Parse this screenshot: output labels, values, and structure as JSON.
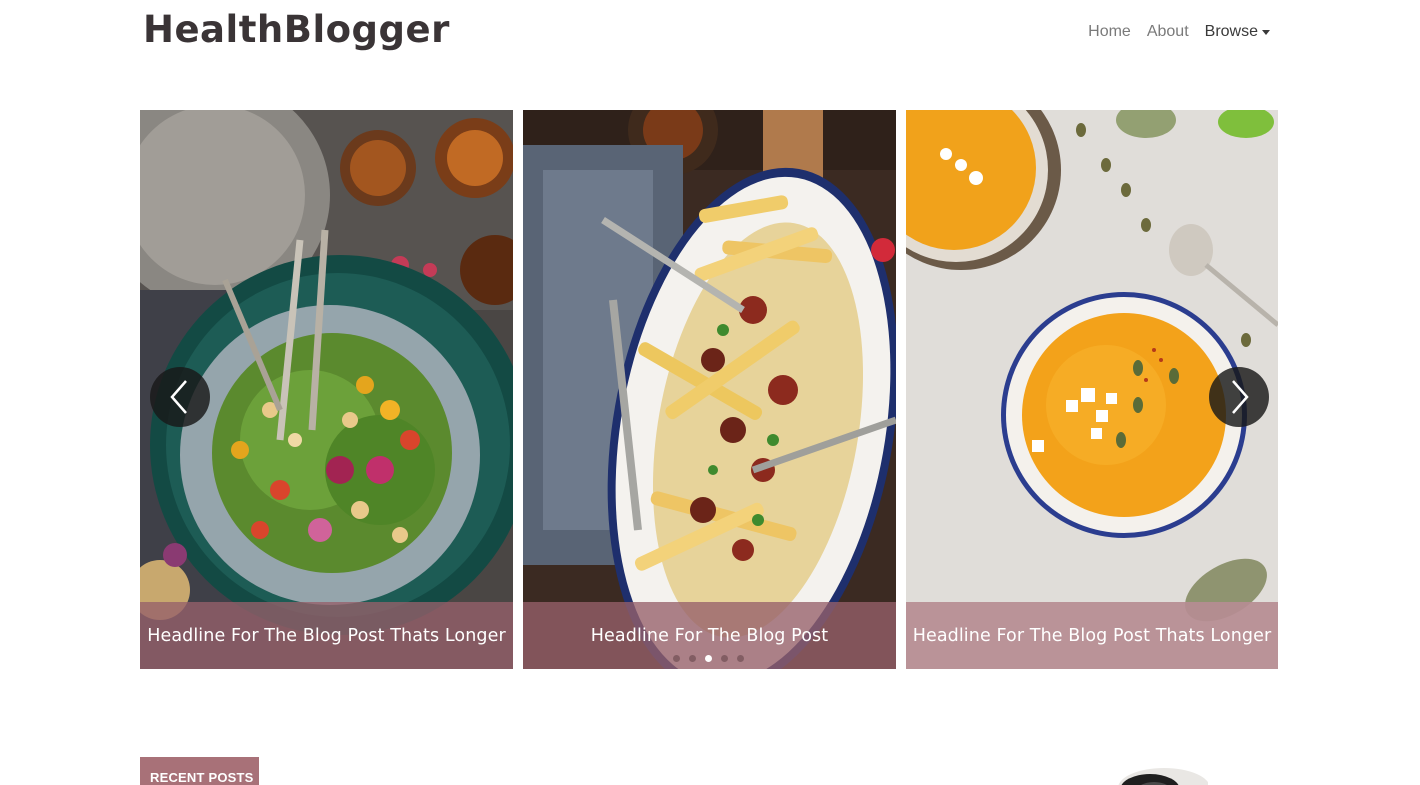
{
  "header": {
    "logo": "HealthBlogger",
    "nav": [
      {
        "label": "Home"
      },
      {
        "label": "About"
      },
      {
        "label": "Browse"
      }
    ]
  },
  "carousel": {
    "slides": [
      {
        "headline": "Headline For The Blog Post Thats Longer",
        "image": "salad bowl with flowers"
      },
      {
        "headline": "Headline For The Blog Post",
        "image": "loaded fries platter"
      },
      {
        "headline": "Headline For The Blog Post Thats Longer",
        "image": "pumpkin soup bowls"
      }
    ],
    "indicator_count": 5,
    "active_indicator": 3,
    "prev_icon": "chevron-left-icon",
    "next_icon": "chevron-right-icon"
  },
  "recent_posts": {
    "label": "RECENT POSTS"
  },
  "colors": {
    "accent": "#a87178",
    "caption_overlay": "#96606a",
    "logo": "#3a3436"
  }
}
